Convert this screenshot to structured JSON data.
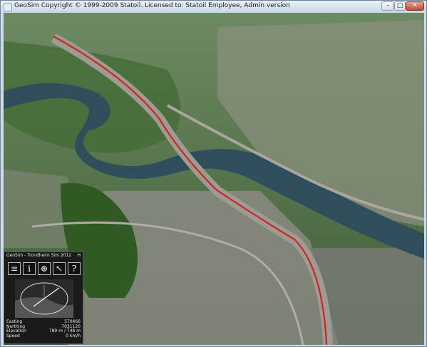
{
  "window": {
    "title": "GeoSim Copyright © 1999-2009 Statoil. Licensed to: Statoil Employee, Admin version",
    "buttons": {
      "minimize": "–",
      "maximize": "□",
      "close": "✕"
    }
  },
  "panel": {
    "title": "GeoSim - Trondheim Sim 2012",
    "header_shortcut": "H",
    "tools": [
      {
        "name": "list-icon",
        "glyph": "≡"
      },
      {
        "name": "info-icon",
        "glyph": "i"
      },
      {
        "name": "globe-icon",
        "glyph": "⊕"
      },
      {
        "name": "tool-icon",
        "glyph": "↖"
      },
      {
        "name": "help-icon",
        "glyph": "?"
      }
    ],
    "readout": [
      {
        "label": "Easting",
        "value": "570466"
      },
      {
        "label": "Northing",
        "value": "7031120"
      },
      {
        "label": "Elevation",
        "value": "789 m / 748 m"
      },
      {
        "label": "Speed",
        "value": "0 km/h"
      }
    ]
  },
  "colors": {
    "route": "#d4241c",
    "titlebar": "#d6e3f0",
    "panel_bg": "#1a1a1a"
  }
}
